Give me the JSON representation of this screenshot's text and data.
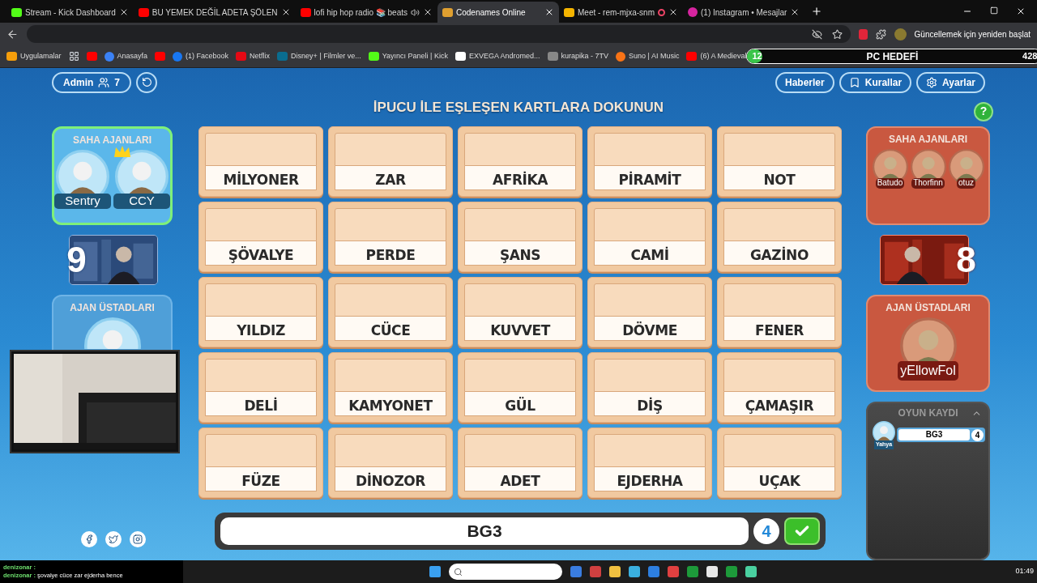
{
  "browser": {
    "tabs": [
      {
        "title": "Stream - Kick Dashboard",
        "selected": false
      },
      {
        "title": "BU YEMEK DEĞİL ADETA ŞÖLEN",
        "selected": false
      },
      {
        "title": "lofi hip hop radio 📚 beats",
        "selected": false,
        "audio": true
      },
      {
        "title": "Codenames Online",
        "selected": true
      },
      {
        "title": "Meet - rem-mjxa-snm",
        "selected": false,
        "recording": true
      },
      {
        "title": "(1) Instagram • Mesajlar",
        "selected": false
      }
    ],
    "update_button": "Güncellemek için yeniden başlat",
    "bookmarks": [
      "Uygulamalar",
      "Anasayfa",
      "(1) Facebook",
      "Netflix",
      "Disney+ | Filmler ve...",
      "Yayıncı Paneli | Kick",
      "EXVEGA Andromed...",
      "kurapika - 7TV",
      "Suno | AI Music",
      "(6) A Medieval"
    ]
  },
  "goal": {
    "current": "12",
    "label": "PC HEDEFİ",
    "target": "428",
    "level": 0.03
  },
  "game": {
    "admin": "Admin",
    "players_count": "7",
    "top_buttons": [
      "Haberler",
      "Kurallar",
      "Ayarlar"
    ],
    "instruction": "İPUCU İLE EŞLEŞEN KARTLARA DOKUNUN",
    "help": "?",
    "teams": [
      {
        "kind": "blue",
        "active": true,
        "operatives_title": "SAHA AJANLARI",
        "operatives": [
          {
            "name": "Sentry",
            "crowned": false
          },
          {
            "name": "CCY",
            "crowned": true
          }
        ],
        "score": "9",
        "spymaster_title": "AJAN ÜSTADLARI"
      },
      {
        "kind": "red",
        "active": false,
        "operatives_title": "SAHA AJANLARI",
        "operatives": [
          {
            "name": "Batudo",
            "crowned": false
          },
          {
            "name": "Thorfinn",
            "crowned": false
          },
          {
            "name": "otuz",
            "crowned": false
          }
        ],
        "score": "8",
        "spymaster_title": "AJAN ÜSTADLARI",
        "spymasters": [
          "yEllowFol"
        ]
      }
    ],
    "cards": [
      "MİLYONER",
      "ZAR",
      "AFRİKA",
      "PİRAMİT",
      "NOT",
      "ŞÖVALYE",
      "PERDE",
      "ŞANS",
      "CAMİ",
      "GAZİNO",
      "YILDIZ",
      "CÜCE",
      "KUVVET",
      "DÖVME",
      "FENER",
      "DELİ",
      "KAMYONET",
      "GÜL",
      "DİŞ",
      "ÇAMAŞIR",
      "FÜZE",
      "DİNOZOR",
      "ADET",
      "EJDERHA",
      "UÇAK"
    ],
    "clue": {
      "word": "BG3",
      "count": "4"
    },
    "log": {
      "title": "OYUN KAYDI",
      "entries": [
        {
          "player": "Yahya",
          "clue": "BG3",
          "count": "4"
        }
      ]
    }
  },
  "chat": [
    {
      "user": "denizonar :"
    },
    {
      "user": "denizonar :",
      "message": "şovalye cüce zar ejderha bence"
    }
  ],
  "taskbar": {
    "time": "01:49"
  }
}
